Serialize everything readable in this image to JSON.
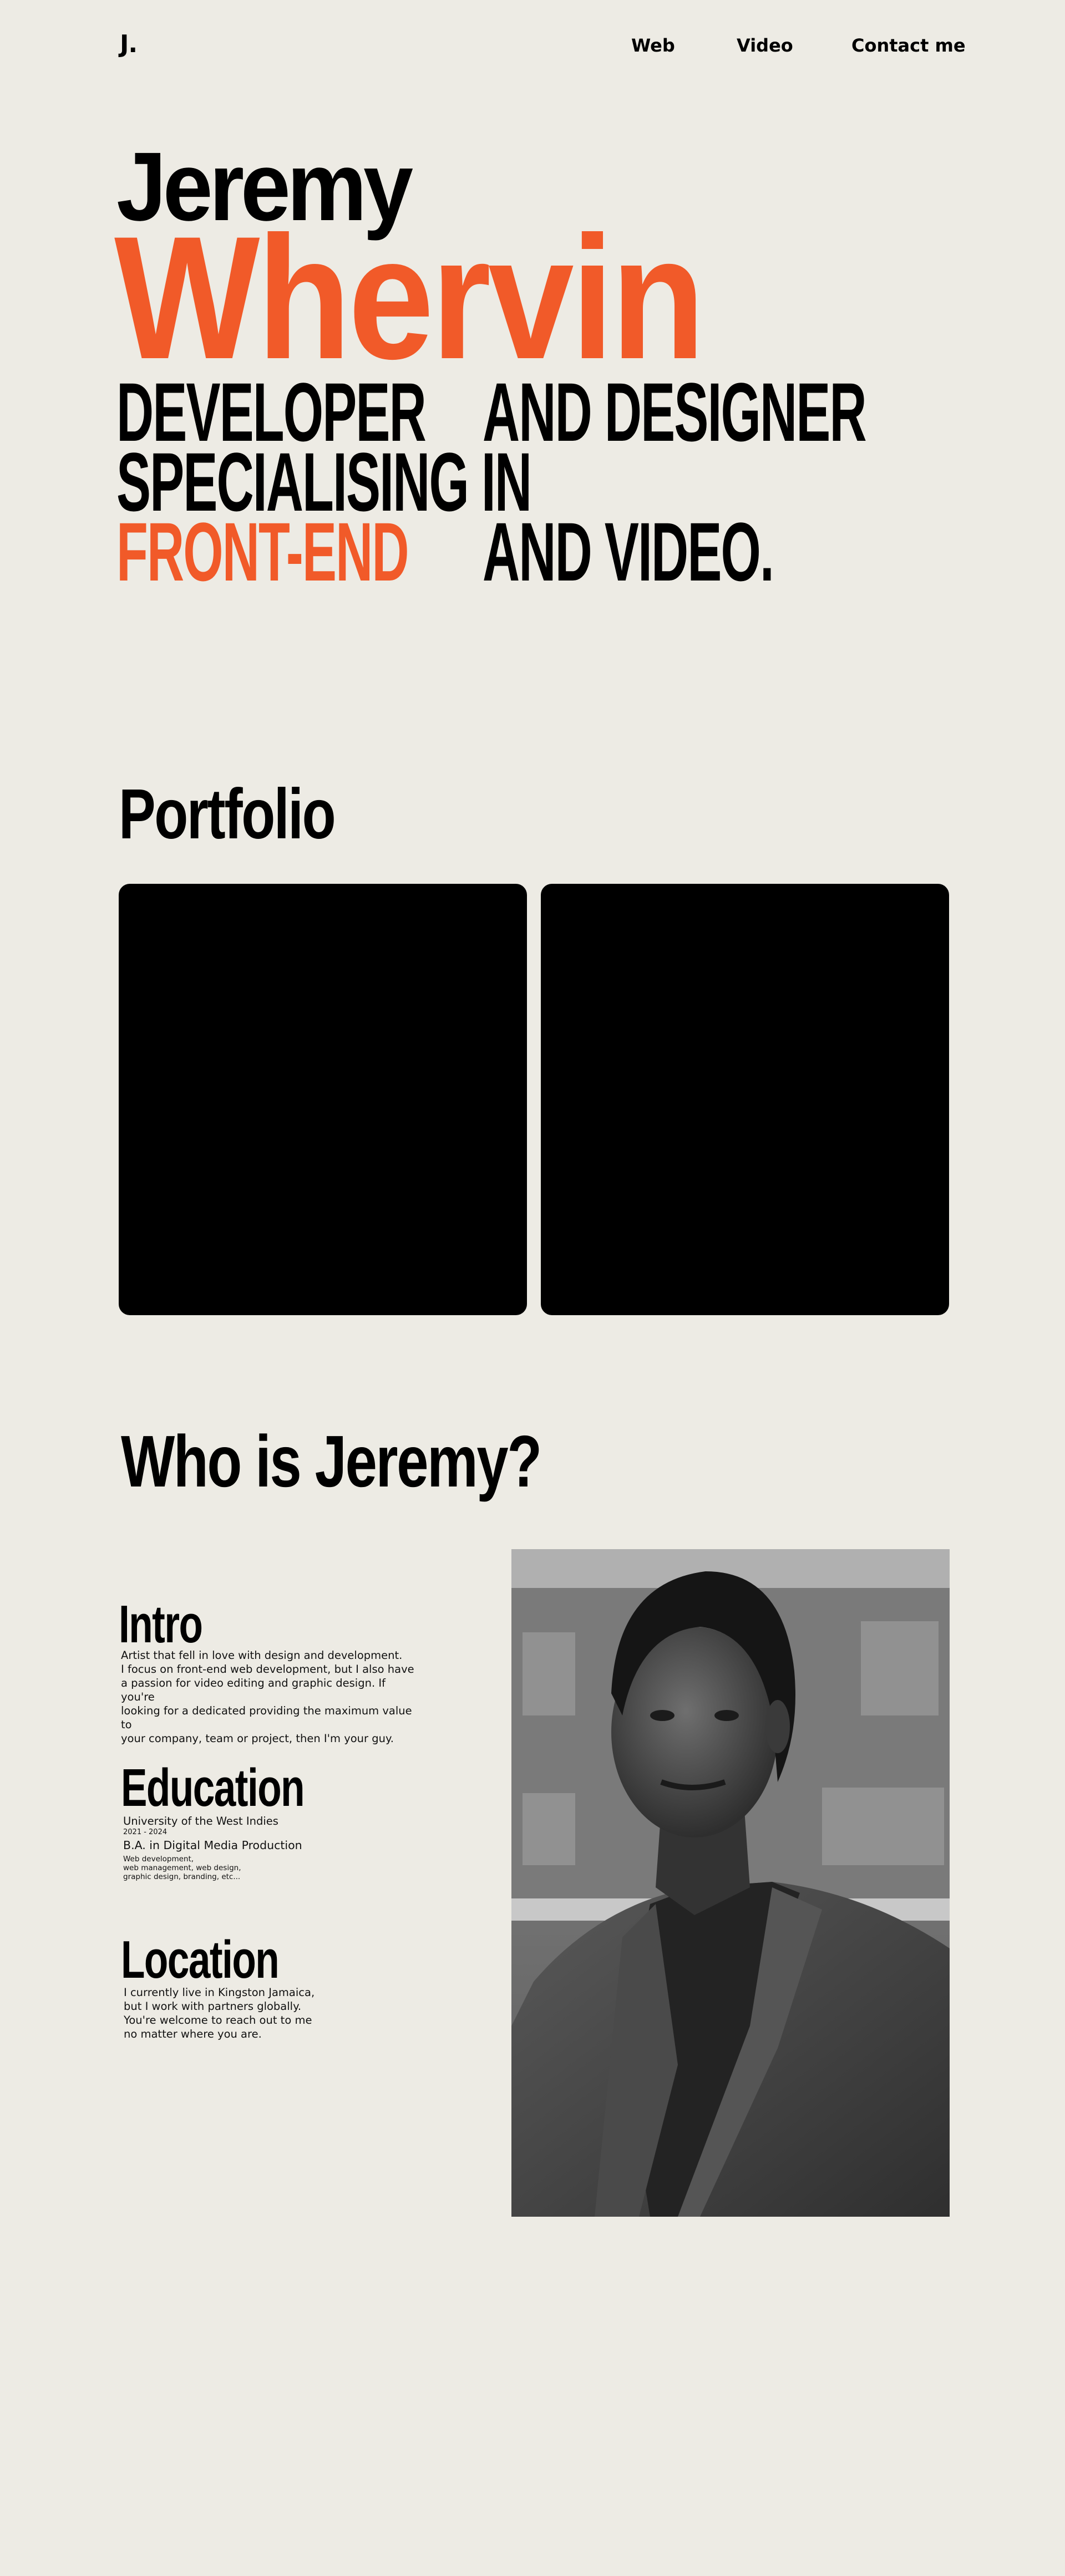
{
  "nav": {
    "logo": "J.",
    "links": [
      {
        "label": "Web"
      },
      {
        "label": "Video"
      },
      {
        "label": "Contact me"
      }
    ]
  },
  "hero": {
    "first_name": "Jeremy",
    "last_name": "Whervin",
    "tagline": {
      "line1_a": "DEVELOPER",
      "line1_b": "AND DESIGNER",
      "line2": "SPECIALISING IN",
      "line3_highlight": "FRONT-END",
      "line3_b": "AND VIDEO."
    },
    "accent_color": "#f15a29"
  },
  "portfolio": {
    "title": "Portfolio"
  },
  "about": {
    "title": "Who is Jeremy?",
    "intro": {
      "title": "Intro",
      "text": "Artist that fell in love with design and development.\nI focus on front-end web development, but I also  have\na passion for video editing and graphic design. If you're\nlooking for a dedicated providing the maximum value to\nyour company, team or project, then I'm your guy."
    },
    "education": {
      "title": "Education",
      "university": "University of the West Indies",
      "years": "2021 - 2024",
      "degree": "B.A. in Digital Media Production",
      "details": "Web development,\nweb management, web design,\ngraphic design, branding, etc..."
    },
    "location": {
      "title": "Location",
      "text": "I currently live in Kingston Jamaica,\nbut I work with partners globally.\nYou're welcome to reach out to me\nno matter where you are."
    }
  },
  "colors": {
    "background": "#edebe4",
    "text": "#000000",
    "accent": "#f15a29",
    "card": "#000000"
  }
}
